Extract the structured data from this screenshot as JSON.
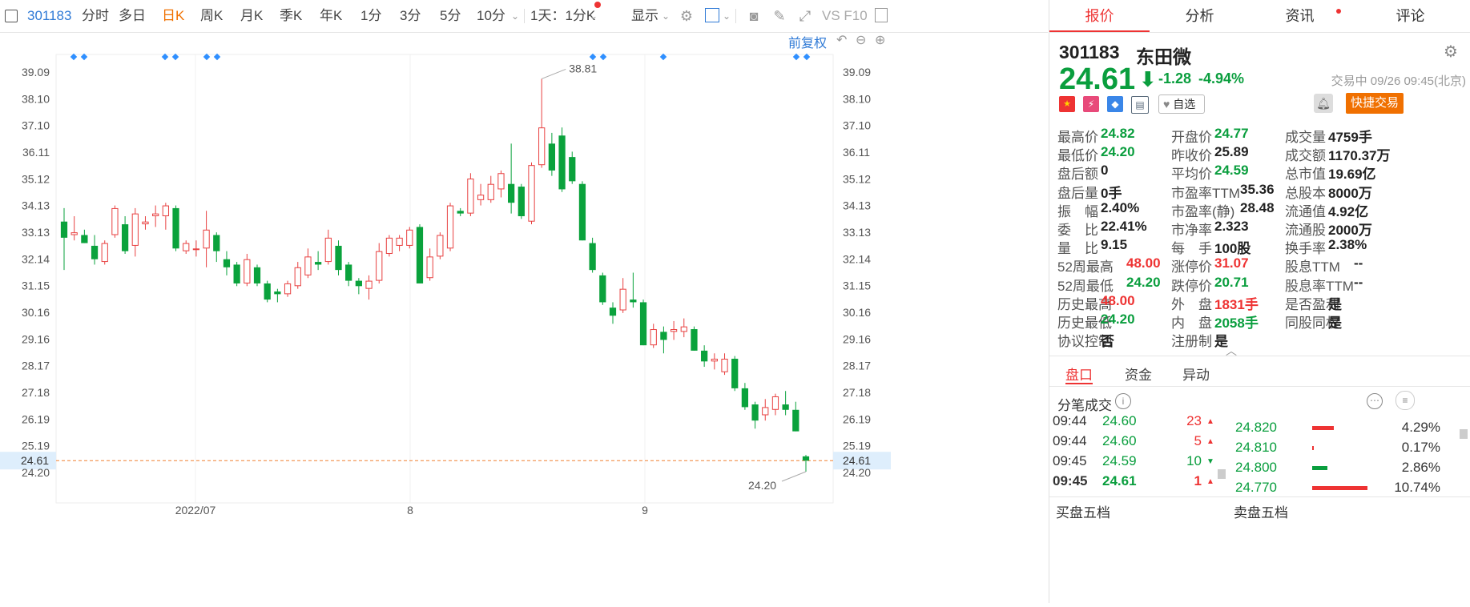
{
  "toolbar": {
    "code": "301183",
    "periods": [
      "分时",
      "多日",
      "日K",
      "周K",
      "月K",
      "季K",
      "年K",
      "1分",
      "3分",
      "5分",
      "10分"
    ],
    "active_period": "日K",
    "interval": "1天：1分K",
    "display": "显示",
    "f10": "VS F10",
    "adjust": "前复权"
  },
  "chart": {
    "y_ticks": [
      "39.09",
      "38.10",
      "37.10",
      "36.11",
      "35.12",
      "34.13",
      "33.13",
      "32.14",
      "31.15",
      "30.16",
      "29.16",
      "28.17",
      "27.18",
      "26.19",
      "25.19",
      "24.20"
    ],
    "x_labels": [
      "2022/07",
      "8",
      "9"
    ],
    "current_price_label": "24.61",
    "high_label": "38.81",
    "low_label": "24.20"
  },
  "chart_data": {
    "type": "candlestick",
    "ylim": [
      24.2,
      39.09
    ],
    "current_price": 24.61,
    "candles": [
      {
        "o": 33.5,
        "c": 32.9,
        "h": 34.0,
        "l": 31.7
      },
      {
        "o": 33.0,
        "c": 33.1,
        "h": 33.7,
        "l": 32.8
      },
      {
        "o": 33.0,
        "c": 32.7,
        "h": 33.2,
        "l": 32.7
      },
      {
        "o": 32.6,
        "c": 32.1,
        "h": 33.0,
        "l": 31.9
      },
      {
        "o": 32.0,
        "c": 32.7,
        "h": 32.8,
        "l": 31.9
      },
      {
        "o": 33.0,
        "c": 34.0,
        "h": 34.1,
        "l": 32.9
      },
      {
        "o": 33.4,
        "c": 32.4,
        "h": 33.7,
        "l": 32.3
      },
      {
        "o": 32.6,
        "c": 33.8,
        "h": 34.0,
        "l": 32.2
      },
      {
        "o": 33.4,
        "c": 33.5,
        "h": 33.7,
        "l": 33.2
      },
      {
        "o": 33.7,
        "c": 33.8,
        "h": 34.1,
        "l": 33.3
      },
      {
        "o": 33.7,
        "c": 34.1,
        "h": 34.2,
        "l": 33.2
      },
      {
        "o": 34.0,
        "c": 32.5,
        "h": 34.1,
        "l": 32.4
      },
      {
        "o": 32.4,
        "c": 32.7,
        "h": 32.8,
        "l": 32.3
      },
      {
        "o": 32.5,
        "c": 32.5,
        "h": 32.8,
        "l": 32.2
      },
      {
        "o": 32.5,
        "c": 33.2,
        "h": 33.9,
        "l": 31.8
      },
      {
        "o": 33.0,
        "c": 32.4,
        "h": 33.1,
        "l": 32.0
      },
      {
        "o": 32.1,
        "c": 31.8,
        "h": 32.4,
        "l": 31.5
      },
      {
        "o": 31.9,
        "c": 31.2,
        "h": 32.0,
        "l": 31.1
      },
      {
        "o": 31.2,
        "c": 32.1,
        "h": 32.3,
        "l": 31.1
      },
      {
        "o": 31.8,
        "c": 31.2,
        "h": 31.9,
        "l": 31.1
      },
      {
        "o": 31.2,
        "c": 30.6,
        "h": 31.3,
        "l": 30.5
      },
      {
        "o": 30.9,
        "c": 30.8,
        "h": 31.0,
        "l": 30.5
      },
      {
        "o": 30.8,
        "c": 31.2,
        "h": 31.3,
        "l": 30.7
      },
      {
        "o": 31.1,
        "c": 31.8,
        "h": 32.0,
        "l": 31.0
      },
      {
        "o": 31.5,
        "c": 32.2,
        "h": 32.5,
        "l": 31.4
      },
      {
        "o": 32.0,
        "c": 31.9,
        "h": 32.4,
        "l": 31.7
      },
      {
        "o": 32.0,
        "c": 32.9,
        "h": 33.2,
        "l": 31.9
      },
      {
        "o": 32.6,
        "c": 31.7,
        "h": 32.8,
        "l": 31.5
      },
      {
        "o": 31.9,
        "c": 31.3,
        "h": 32.0,
        "l": 31.1
      },
      {
        "o": 31.3,
        "c": 31.1,
        "h": 31.4,
        "l": 30.8
      },
      {
        "o": 31.0,
        "c": 31.3,
        "h": 31.5,
        "l": 30.6
      },
      {
        "o": 31.3,
        "c": 32.4,
        "h": 32.7,
        "l": 31.2
      },
      {
        "o": 32.3,
        "c": 32.9,
        "h": 33.0,
        "l": 32.2
      },
      {
        "o": 32.6,
        "c": 32.9,
        "h": 33.0,
        "l": 32.4
      },
      {
        "o": 32.6,
        "c": 33.2,
        "h": 33.3,
        "l": 32.5
      },
      {
        "o": 33.3,
        "c": 31.2,
        "h": 33.4,
        "l": 31.2
      },
      {
        "o": 31.4,
        "c": 32.2,
        "h": 32.5,
        "l": 31.3
      },
      {
        "o": 32.2,
        "c": 33.0,
        "h": 33.1,
        "l": 32.1
      },
      {
        "o": 32.5,
        "c": 34.1,
        "h": 34.2,
        "l": 32.4
      },
      {
        "o": 33.9,
        "c": 33.8,
        "h": 34.0,
        "l": 33.7
      },
      {
        "o": 33.8,
        "c": 35.1,
        "h": 35.3,
        "l": 33.7
      },
      {
        "o": 34.3,
        "c": 34.5,
        "h": 34.9,
        "l": 34.1
      },
      {
        "o": 34.3,
        "c": 34.9,
        "h": 35.2,
        "l": 34.2
      },
      {
        "o": 34.7,
        "c": 35.3,
        "h": 35.4,
        "l": 34.4
      },
      {
        "o": 34.9,
        "c": 34.2,
        "h": 36.4,
        "l": 33.8
      },
      {
        "o": 34.8,
        "c": 33.7,
        "h": 34.9,
        "l": 33.6
      },
      {
        "o": 33.5,
        "c": 35.6,
        "h": 35.7,
        "l": 33.4
      },
      {
        "o": 35.6,
        "c": 37.0,
        "h": 38.81,
        "l": 35.5
      },
      {
        "o": 36.4,
        "c": 35.4,
        "h": 36.8,
        "l": 35.2
      },
      {
        "o": 36.7,
        "c": 34.7,
        "h": 37.0,
        "l": 34.6
      },
      {
        "o": 35.9,
        "c": 35.0,
        "h": 36.1,
        "l": 34.9
      },
      {
        "o": 34.9,
        "c": 32.8,
        "h": 35.0,
        "l": 32.8
      },
      {
        "o": 32.7,
        "c": 31.7,
        "h": 32.9,
        "l": 31.6
      },
      {
        "o": 31.5,
        "c": 30.5,
        "h": 31.6,
        "l": 30.4
      },
      {
        "o": 30.3,
        "c": 30.0,
        "h": 30.5,
        "l": 29.7
      },
      {
        "o": 30.2,
        "c": 31.0,
        "h": 31.4,
        "l": 30.1
      },
      {
        "o": 30.6,
        "c": 30.5,
        "h": 31.6,
        "l": 30.3
      },
      {
        "o": 30.5,
        "c": 28.9,
        "h": 30.6,
        "l": 28.9
      },
      {
        "o": 28.9,
        "c": 29.5,
        "h": 29.7,
        "l": 28.8
      },
      {
        "o": 29.4,
        "c": 29.1,
        "h": 29.6,
        "l": 28.6
      },
      {
        "o": 29.4,
        "c": 29.5,
        "h": 29.8,
        "l": 29.1
      },
      {
        "o": 29.4,
        "c": 29.6,
        "h": 29.9,
        "l": 29.2
      },
      {
        "o": 29.5,
        "c": 28.7,
        "h": 29.6,
        "l": 28.7
      },
      {
        "o": 28.7,
        "c": 28.3,
        "h": 28.9,
        "l": 28.1
      },
      {
        "o": 28.3,
        "c": 28.4,
        "h": 28.6,
        "l": 28.0
      },
      {
        "o": 27.9,
        "c": 28.4,
        "h": 28.6,
        "l": 27.8
      },
      {
        "o": 28.4,
        "c": 27.3,
        "h": 28.5,
        "l": 27.2
      },
      {
        "o": 27.3,
        "c": 26.6,
        "h": 27.5,
        "l": 26.5
      },
      {
        "o": 26.7,
        "c": 26.1,
        "h": 26.8,
        "l": 25.8
      },
      {
        "o": 26.3,
        "c": 26.6,
        "h": 26.9,
        "l": 26.1
      },
      {
        "o": 26.5,
        "c": 27.0,
        "h": 27.1,
        "l": 26.3
      },
      {
        "o": 26.7,
        "c": 26.5,
        "h": 27.2,
        "l": 26.3
      },
      {
        "o": 26.5,
        "c": 25.7,
        "h": 26.8,
        "l": 25.7
      },
      {
        "o": 24.77,
        "c": 24.61,
        "h": 24.82,
        "l": 24.2
      }
    ]
  },
  "stock": {
    "code": "301183",
    "name": "东田微",
    "price": "24.61",
    "change": "-1.28",
    "change_pct": "-4.94%",
    "time": "交易中 09/26 09:45(北京)",
    "watch": "自选",
    "trade_btn": "快捷交易"
  },
  "tabs": [
    "报价",
    "分析",
    "资讯",
    "评论"
  ],
  "stats": [
    [
      [
        "最高价",
        "24.82",
        "green"
      ],
      [
        "开盘价",
        "24.77",
        "green"
      ],
      [
        "成交量",
        "4759手",
        "blk"
      ]
    ],
    [
      [
        "最低价",
        "24.20",
        "green"
      ],
      [
        "昨收价",
        "25.89",
        "blk"
      ],
      [
        "成交额",
        "1170.37万",
        "blk"
      ]
    ],
    [
      [
        "盘后额",
        "0",
        "blk"
      ],
      [
        "平均价",
        "24.59",
        "green"
      ],
      [
        "总市值",
        "19.69亿",
        "blk"
      ]
    ],
    [
      [
        "盘后量",
        "0手",
        "blk"
      ],
      [
        "市盈率TTM",
        "35.36",
        "blk"
      ],
      [
        "总股本",
        "8000万",
        "blk"
      ]
    ],
    [
      [
        "振　幅",
        "2.40%",
        "blk"
      ],
      [
        "市盈率(静)",
        "28.48",
        "blk"
      ],
      [
        "流通值",
        "4.92亿",
        "blk"
      ]
    ],
    [
      [
        "委　比",
        "22.41%",
        "blk"
      ],
      [
        "市净率",
        "2.323",
        "blk"
      ],
      [
        "流通股",
        "2000万",
        "blk"
      ]
    ],
    [
      [
        "量　比",
        "9.15",
        "blk"
      ],
      [
        "每　手",
        "100股",
        "blk"
      ],
      [
        "换手率",
        "2.38%",
        "blk"
      ]
    ],
    [
      [
        "52周最高",
        "48.00",
        "red"
      ],
      [
        "涨停价",
        "31.07",
        "red"
      ],
      [
        "股息TTM",
        "--",
        "blk"
      ]
    ],
    [
      [
        "52周最低",
        "24.20",
        "green"
      ],
      [
        "跌停价",
        "20.71",
        "green"
      ],
      [
        "股息率TTM",
        "--",
        "blk"
      ]
    ],
    [
      [
        "历史最高",
        "48.00",
        "red"
      ],
      [
        "外　盘",
        "1831手",
        "red"
      ],
      [
        "是否盈利",
        "是",
        "blk"
      ]
    ],
    [
      [
        "历史最低",
        "24.20",
        "green"
      ],
      [
        "内　盘",
        "2058手",
        "green"
      ],
      [
        "同股同权",
        "是",
        "blk"
      ]
    ],
    [
      [
        "协议控制",
        "否",
        "blk"
      ],
      [
        "注册制",
        "是",
        "blk"
      ],
      [
        "",
        "",
        " "
      ]
    ]
  ],
  "subtabs": [
    "盘口",
    "资金",
    "异动"
  ],
  "ticks_title": "分笔成交",
  "ticks": [
    {
      "time": "09:44",
      "price": "24.60",
      "vol": "23",
      "dir": "up"
    },
    {
      "time": "09:44",
      "price": "24.60",
      "vol": "5",
      "dir": "up"
    },
    {
      "time": "09:45",
      "price": "24.59",
      "vol": "10",
      "dir": "down"
    },
    {
      "time": "09:45",
      "price": "24.61",
      "vol": "1",
      "dir": "up"
    }
  ],
  "dist": [
    {
      "price": "24.820",
      "pct": "4.29%",
      "color": "#e33",
      "frac": 0.13
    },
    {
      "price": "24.810",
      "pct": "0.17%",
      "color": "#e33",
      "frac": 0.01
    },
    {
      "price": "24.800",
      "pct": "2.86%",
      "color": "#0a9e3e",
      "frac": 0.09
    },
    {
      "price": "24.770",
      "pct": "10.74%",
      "color": "#e33",
      "frac": 0.33
    }
  ],
  "bottom": [
    "买盘五档",
    "卖盘五档"
  ]
}
